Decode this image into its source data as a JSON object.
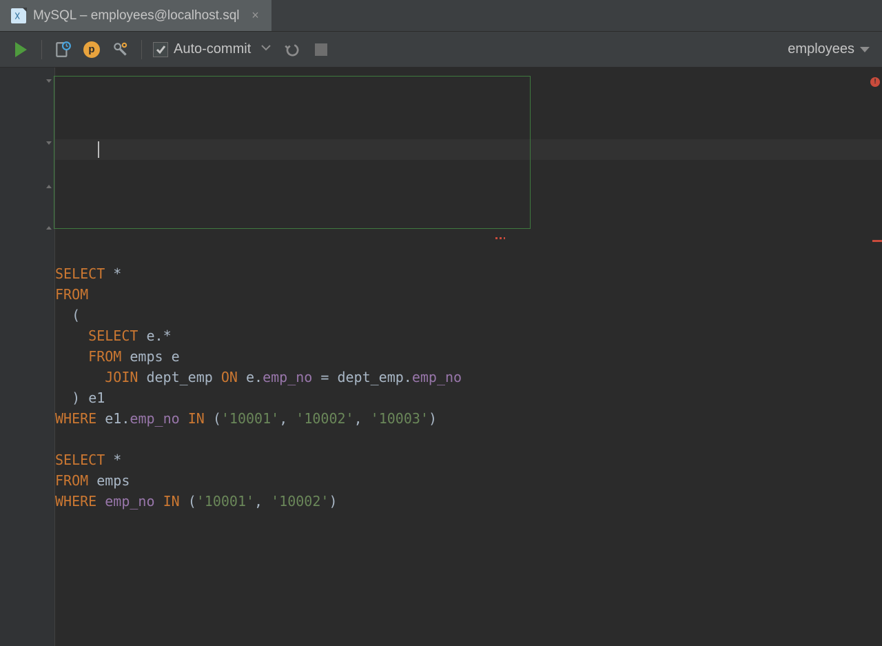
{
  "tab": {
    "title": "MySQL – employees@localhost.sql",
    "icon": "db-file-icon"
  },
  "toolbar": {
    "run": "Run",
    "plan": "Execution plan",
    "p_badge": "p",
    "settings": "Settings",
    "auto_commit_label": "Auto-commit",
    "auto_commit_checked": true,
    "undo": "Rollback",
    "stop": "Stop",
    "schema": "employees"
  },
  "editor": {
    "language": "SQL",
    "lines": [
      "SELECT *",
      "FROM",
      "  (",
      "    SELECT e.*",
      "    FROM emps e",
      "      JOIN dept_emp ON e.emp_no = dept_emp.emp_no",
      "  ) e1",
      "WHERE e1.emp_no IN ('10001', '10002', '10003')",
      "",
      "SELECT *",
      "FROM emps",
      "WHERE emp_no IN ('10001', '10002')"
    ],
    "q1_where_literals": [
      "10001",
      "10002",
      "10003"
    ],
    "q2_where_literals": [
      "10001",
      "10002"
    ],
    "error_present": true
  },
  "colors": {
    "keyword": "#cc7832",
    "identifier_col": "#9876aa",
    "string": "#6a8759",
    "default_text": "#a9b7c6",
    "bg_editor": "#2b2b2b",
    "bg_chrome": "#3c3f41",
    "stmt_highlight_border": "#3f7a3f"
  }
}
